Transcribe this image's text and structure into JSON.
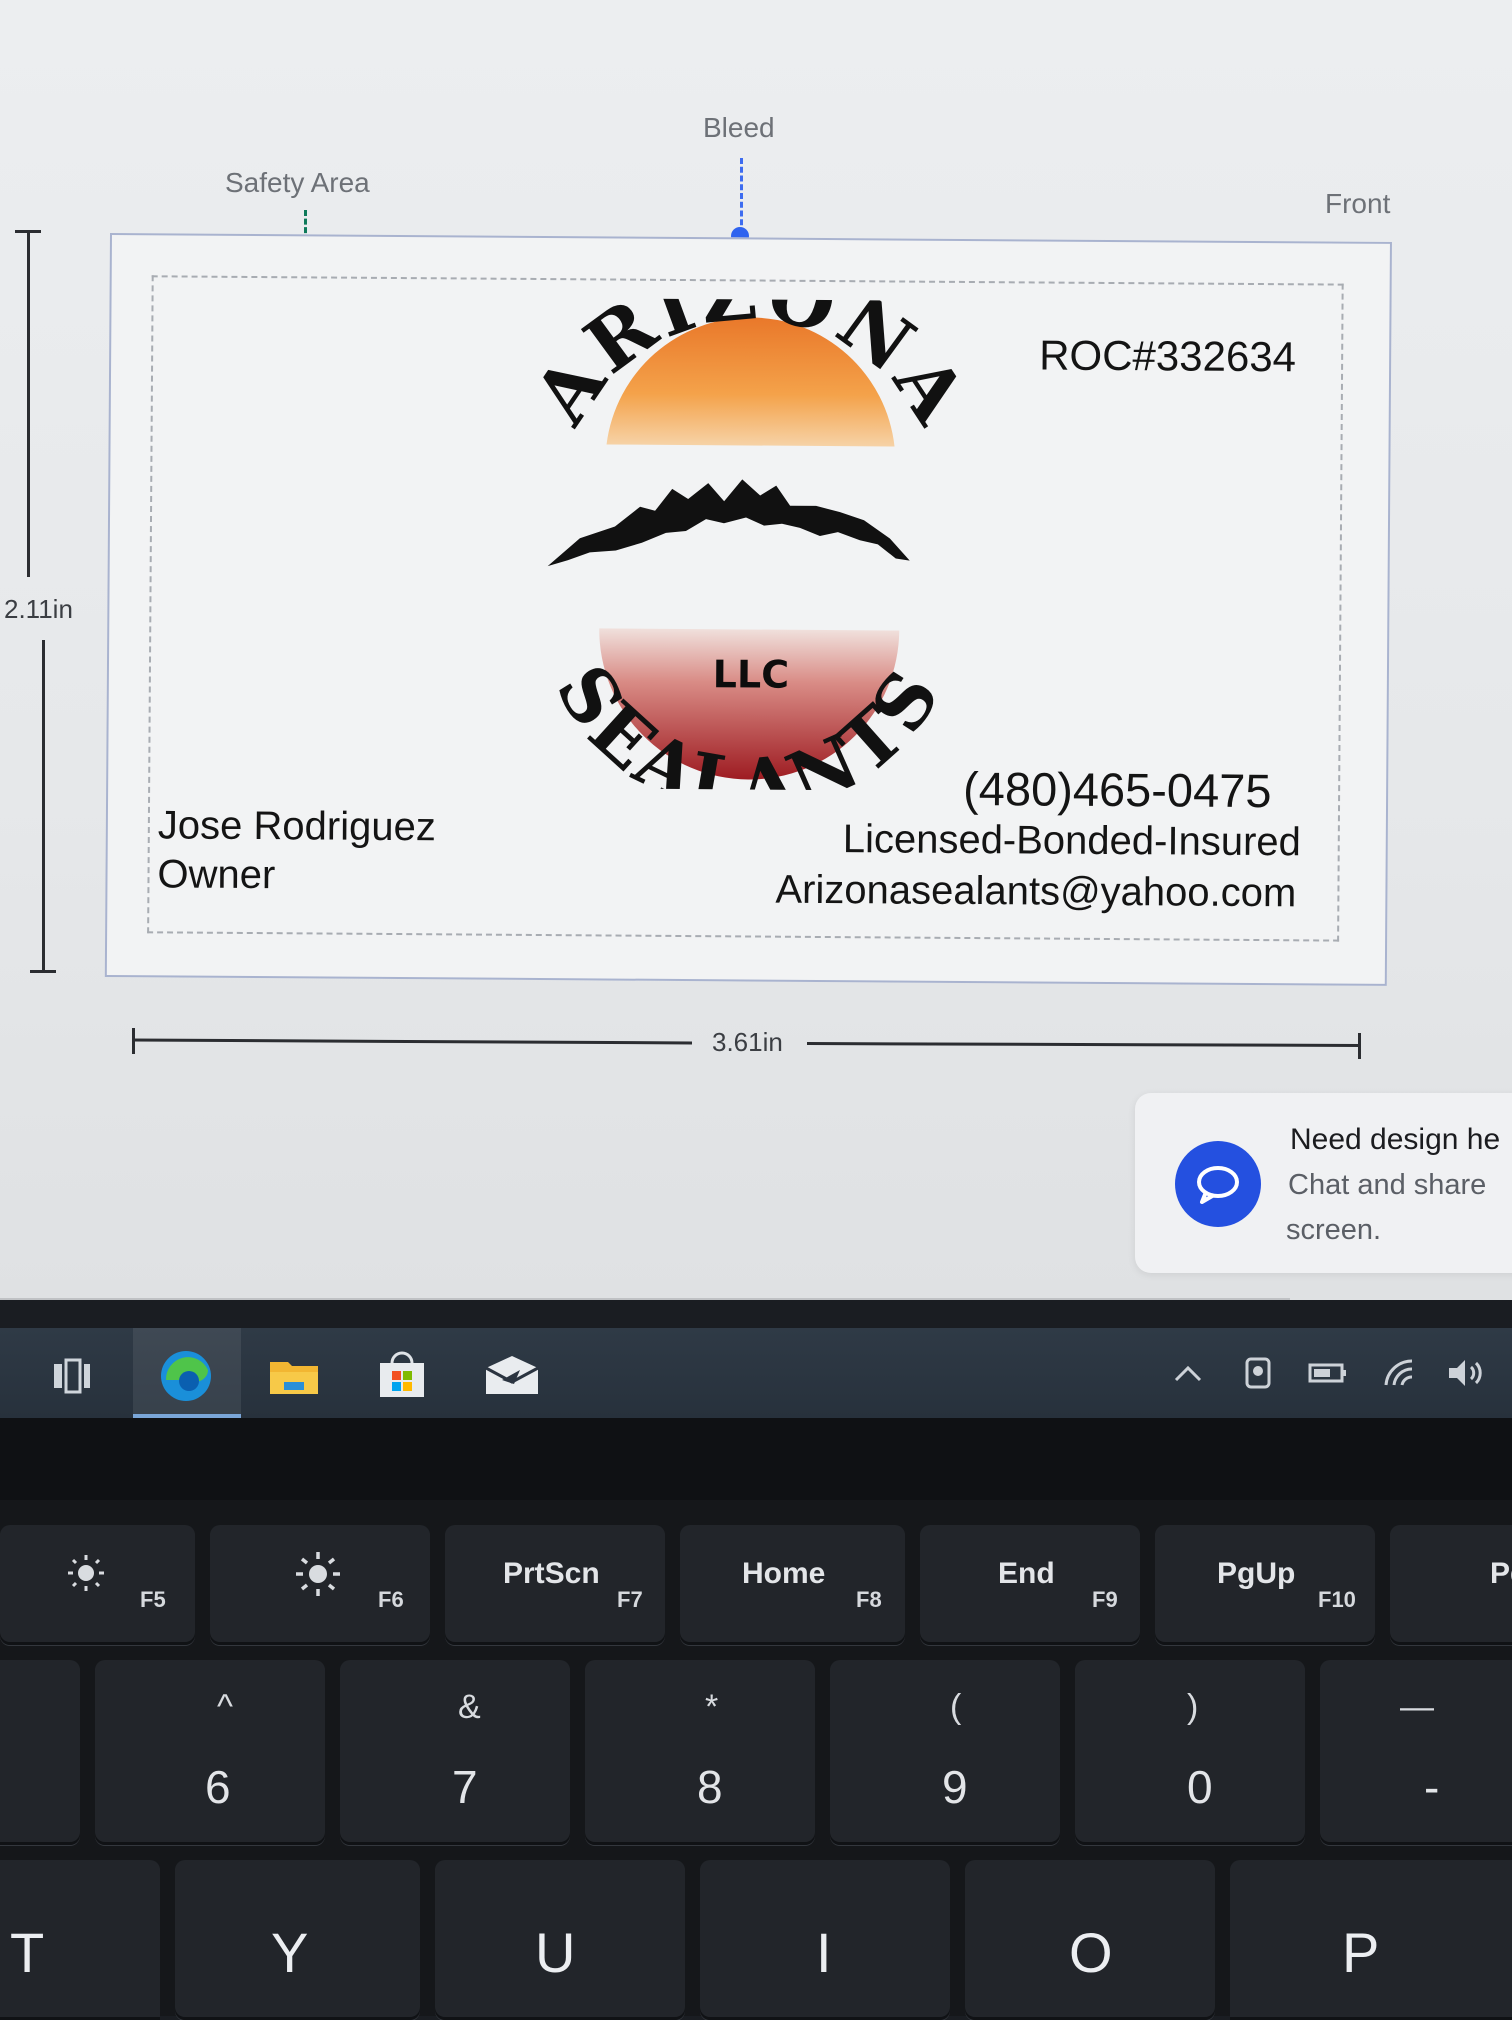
{
  "canvas": {
    "labels": {
      "bleed": "Bleed",
      "safety_area": "Safety Area",
      "front": "Front"
    },
    "dimensions": {
      "height": "2.11in",
      "width": "3.61in"
    },
    "colors": {
      "bleed": "#2f63ef",
      "safety": "#0e7a5a"
    }
  },
  "card": {
    "logo": {
      "top_text": "ARIZONA",
      "bottom_text": "SEALANTS",
      "middle_text": "LLC"
    },
    "roc": "ROC#332634",
    "phone": "(480)465-0475",
    "licensed": "Licensed-Bonded-Insured",
    "email": "Arizonasealants@yahoo.com",
    "name": "Jose Rodriguez",
    "role": "Owner"
  },
  "chat": {
    "title": "Need design he",
    "line1": "Chat and share",
    "line2": "screen.",
    "icon": "chat-bubble-icon"
  },
  "taskbar": {
    "icons": [
      "task-view-icon",
      "edge-icon",
      "file-explorer-icon",
      "store-icon",
      "mail-icon"
    ],
    "tray_icons": [
      "chevron-up-icon",
      "meet-now-icon",
      "battery-icon",
      "wifi-icon",
      "volume-icon"
    ]
  },
  "keyboard": {
    "fn_row": [
      {
        "main": "",
        "sub": "F5"
      },
      {
        "main": "",
        "sub": "F6"
      },
      {
        "main": "PrtScn",
        "sub": "F7"
      },
      {
        "main": "Home",
        "sub": "F8"
      },
      {
        "main": "End",
        "sub": "F9"
      },
      {
        "main": "PgUp",
        "sub": "F10"
      },
      {
        "main": "PgD",
        "sub": ""
      }
    ],
    "num_row": [
      {
        "top": "^",
        "bottom": "6"
      },
      {
        "top": "&",
        "bottom": "7"
      },
      {
        "top": "*",
        "bottom": "8"
      },
      {
        "top": "(",
        "bottom": "9"
      },
      {
        "top": ")",
        "bottom": "0"
      },
      {
        "top": "—",
        "bottom": "-"
      }
    ],
    "letter_row": [
      "T",
      "Y",
      "U",
      "I",
      "O",
      "P"
    ]
  }
}
